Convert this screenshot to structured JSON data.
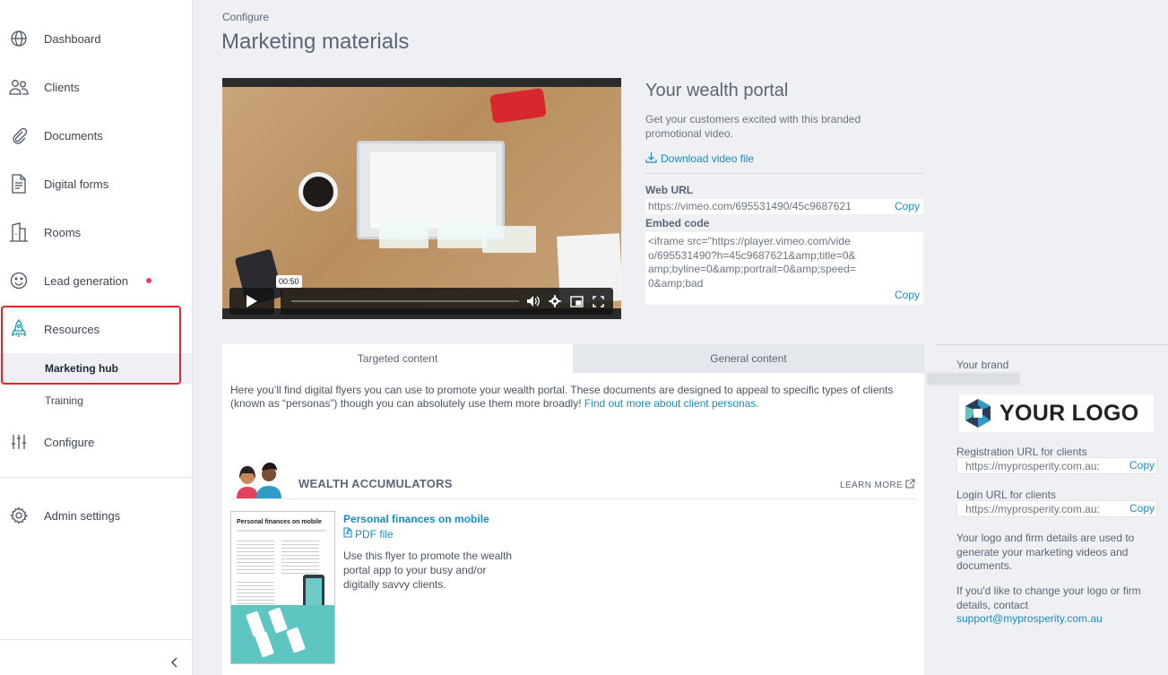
{
  "sidebar": {
    "items": [
      {
        "label": "Dashboard",
        "icon": "globe-icon"
      },
      {
        "label": "Clients",
        "icon": "users-icon"
      },
      {
        "label": "Documents",
        "icon": "paperclip-icon"
      },
      {
        "label": "Digital forms",
        "icon": "form-icon"
      },
      {
        "label": "Rooms",
        "icon": "building-icon"
      },
      {
        "label": "Lead generation",
        "icon": "smiley-icon"
      },
      {
        "label": "Resources",
        "icon": "rocket-icon"
      },
      {
        "label": "Configure",
        "icon": "sliders-icon"
      },
      {
        "label": "Admin settings",
        "icon": "gear-icon"
      }
    ],
    "sub_items": [
      {
        "label": "Marketing hub",
        "active": true
      },
      {
        "label": "Training",
        "active": false
      }
    ],
    "collapse_icon": "chevron-left-icon"
  },
  "header": {
    "breadcrumb": "Configure",
    "title": "Marketing materials"
  },
  "video": {
    "timestamp": "00:50"
  },
  "video_info": {
    "title": "Your wealth portal",
    "description": "Get your customers excited with this branded promotional video.",
    "download_label": "Download video file",
    "web_url_label": "Web URL",
    "web_url": "https://vimeo.com/695531490/45c9687621",
    "embed_label": "Embed code",
    "embed_code": "<iframe src=\"https://player.vimeo.com/video/695531490?h=45c9687621&amp;title=0&amp;byline=0&amp;portrait=0&amp;speed=0&amp;bad",
    "copy_label": "Copy"
  },
  "tabs": [
    {
      "label": "Targeted content",
      "active": true
    },
    {
      "label": "General content",
      "active": false
    }
  ],
  "targeted": {
    "intro": "Here you’ll find digital flyers you can use to promote your wealth portal. These documents are designed to appeal to specific types of clients (known as “personas”) though you can absolutely use them more broadly!",
    "intro_link": "Find out more about client personas.",
    "persona_title": "WEALTH ACCUMULATORS",
    "learn_more": "LEARN MORE",
    "flyer": {
      "title": "Personal finances on mobile",
      "file_label": "PDF file",
      "description": "Use this flyer to promote the wealth portal app to your busy and/or digitally savvy clients.",
      "thumb_heading": "Personal finances on mobile"
    }
  },
  "brand": {
    "label": "Your brand",
    "logo_text": "YOUR LOGO",
    "registration_label": "Registration URL for clients",
    "registration_url": "https://myprosperity.com.au:",
    "login_label": "Login URL for clients",
    "login_url": "https://myprosperity.com.au:",
    "copy_label": "Copy",
    "note1": "Your logo and firm details are used to generate your marketing videos and documents.",
    "note2": "If you'd like to change your logo or firm details, contact",
    "email": "support@myprosperity.com.au"
  },
  "colors": {
    "accent": "#1b8bc5",
    "highlight": "#e4242b",
    "notification_dot": "#e2435c"
  }
}
